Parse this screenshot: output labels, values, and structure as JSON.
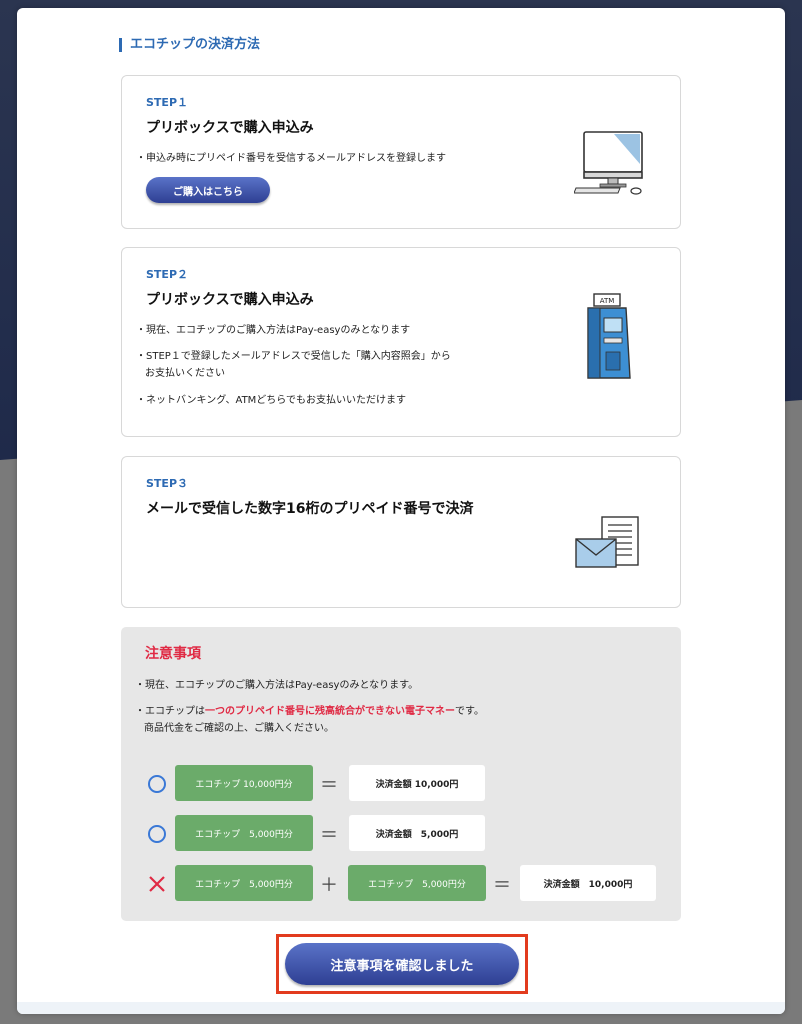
{
  "section_title": "エコチップの決済方法",
  "steps": [
    {
      "label": "STEP１",
      "heading": "プリボックスで購入申込み",
      "bullets": [
        {
          "line1": "・申込み時にプリペイド番号を受信するメールアドレスを登録します",
          "line2": ""
        }
      ],
      "button": "ご購入はこちら",
      "icon": "computer-icon"
    },
    {
      "label": "STEP２",
      "heading": "プリボックスで購入申込み",
      "bullets": [
        {
          "line1": "・現在、エコチップのご購入方法はPay-easyのみとなります",
          "line2": ""
        },
        {
          "line1": "・STEP１で登録したメールアドレスで受信した「購入内容照会」から",
          "line2": "お支払いください"
        },
        {
          "line1": "・ネットバンキング、ATMどちらでもお支払いいただけます",
          "line2": ""
        }
      ],
      "icon": "atm-icon",
      "atm_text": "ATM"
    },
    {
      "label": "STEP３",
      "heading": "メールで受信した数字16桁のプリペイド番号で決済",
      "icon": "mail-document-icon"
    }
  ],
  "notice": {
    "title": "注意事項",
    "line1": "・現在、エコチップのご購入方法はPay-easyのみとなります。",
    "line2_prefix": "・エコチップは",
    "line2_highlight": "一つのプリペイド番号に残高統合ができない電子マネー",
    "line2_suffix": "です。",
    "line3": "商品代金をご確認の上、ご購入ください。",
    "rows": [
      {
        "mark": "circle-icon",
        "chip1": "エコチップ 10,000円分",
        "equals": "＝",
        "total": "決済金額 10,000円"
      },
      {
        "mark": "circle-icon",
        "chip1": "エコチップ　5,000円分",
        "equals": "＝",
        "total": "決済金額　5,000円"
      },
      {
        "mark": "cross-icon",
        "chip1": "エコチップ　5,000円分",
        "plus": "＋",
        "chip2": "エコチップ　5,000円分",
        "equals": "＝",
        "total": "決済金額　10,000円"
      }
    ]
  },
  "confirm_button": "注意事項を確認しました",
  "colors": {
    "accent_blue": "#2d6ab3",
    "warning_red": "#e02a44",
    "chip_green": "#6bab6a",
    "highlight_border": "#e23b1e"
  }
}
